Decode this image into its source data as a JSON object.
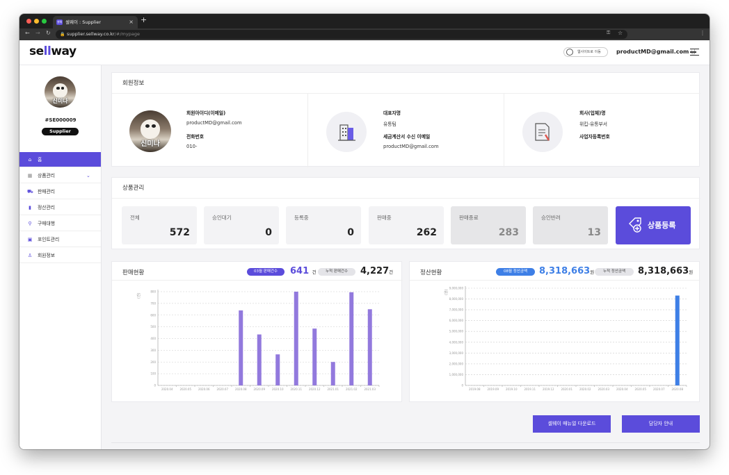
{
  "browser": {
    "tab_title": "셀웨이 : Supplier",
    "tab_favicon_text": "셀웨",
    "url_host": "supplier.sellway.co.kr",
    "url_path": "/#/mypage",
    "traffic_colors": [
      "#ff5f57",
      "#febc2e",
      "#28c840"
    ]
  },
  "header": {
    "logo_prefix": "se",
    "logo_mid": "ll",
    "logo_suffix": "way",
    "site_button_label": "웹사이트로 이동",
    "user_email": "productMD@gmail.com",
    "user_suffix": "님"
  },
  "sidebar": {
    "supplier_id": "#SE000009",
    "role_badge": "Supplier",
    "avatar_name": "신미나",
    "items": [
      {
        "label": "홈",
        "icon": "home-icon",
        "active": true
      },
      {
        "label": "상품관리",
        "icon": "grid-icon",
        "active": false
      },
      {
        "label": "판매관리",
        "icon": "cart-icon",
        "active": false
      },
      {
        "label": "정산관리",
        "icon": "bar-chart-icon",
        "active": false
      },
      {
        "label": "구매대행",
        "icon": "scooter-icon",
        "active": false
      },
      {
        "label": "포인트관리",
        "icon": "wallet-icon",
        "active": false
      },
      {
        "label": "회원정보",
        "icon": "person-icon",
        "active": false
      }
    ]
  },
  "member": {
    "title": "회원정보",
    "id_label": "회원아이디(이메일)",
    "id_value": "productMD@gmail.com",
    "phone_label": "전화번호",
    "phone_value": "010-",
    "rep_label": "대표자명",
    "rep_value": "유통팀",
    "tax_email_label": "세금계산서 수신 이메일",
    "tax_email_value": "productMD@gmail.com",
    "company_label": "회사(업체)명",
    "company_value": "위킵-유통부서",
    "bizno_label": "사업자등록번호",
    "avatar_name": "신미나"
  },
  "products": {
    "title": "상품관리",
    "stats": [
      {
        "label": "전체",
        "value": "572"
      },
      {
        "label": "승인대기",
        "value": "0"
      },
      {
        "label": "등록중",
        "value": "0"
      },
      {
        "label": "판매중",
        "value": "262"
      },
      {
        "label": "판매종료",
        "value": "283"
      },
      {
        "label": "승인반려",
        "value": "13"
      }
    ],
    "register_label": "상품등록"
  },
  "sales": {
    "title": "판매현황",
    "month_pill": "03월 판매건수",
    "month_value": "641",
    "month_unit": "건",
    "total_pill": "누적 판매건수",
    "total_value": "4,227",
    "total_unit": "건"
  },
  "settlement": {
    "title": "정산현황",
    "month_pill": "08월 정산금액",
    "month_value": "8,318,663",
    "month_unit": "원",
    "total_pill": "누적 정산금액",
    "total_value": "8,318,663",
    "total_unit": "원"
  },
  "actions": {
    "manual_label": "셀웨이 매뉴얼 다운로드",
    "manager_label": "담당자 안내"
  },
  "colors": {
    "accent": "#5b4cdb",
    "bar_sales": "#9279dd",
    "bar_settle": "#3e7fe6"
  },
  "chart_data": [
    {
      "type": "bar",
      "title": "판매현황",
      "ylabel": "(건)",
      "categories": [
        "2020.04",
        "2020.05",
        "2020.06",
        "2020.07",
        "2020.08",
        "2020.09",
        "2020.10",
        "2020.11",
        "2020.12",
        "2021.01",
        "2021.02",
        "2021.03"
      ],
      "values": [
        0,
        0,
        0,
        0,
        640,
        435,
        265,
        800,
        485,
        200,
        795,
        650
      ],
      "ylim": [
        0,
        800
      ],
      "yticks": [
        "0",
        "100",
        "200",
        "300",
        "400",
        "500",
        "600",
        "700",
        "800"
      ],
      "grid": true
    },
    {
      "type": "bar",
      "title": "정산현황",
      "ylabel": "(원)",
      "categories": [
        "2019.08",
        "2019.09",
        "2019.10",
        "2019.11",
        "2019.12",
        "2020.01",
        "2020.02",
        "2020.03",
        "2020.04",
        "2020.05",
        "2020.07",
        "2020.08"
      ],
      "values": [
        0,
        0,
        0,
        0,
        0,
        0,
        0,
        0,
        0,
        0,
        0,
        8318663
      ],
      "ylim": [
        0,
        9000000
      ],
      "yticks": [
        "0",
        "1,000,000",
        "2,000,000",
        "3,000,000",
        "4,000,000",
        "5,000,000",
        "6,000,000",
        "7,000,000",
        "8,000,000",
        "9,000,000"
      ],
      "grid": true
    }
  ]
}
